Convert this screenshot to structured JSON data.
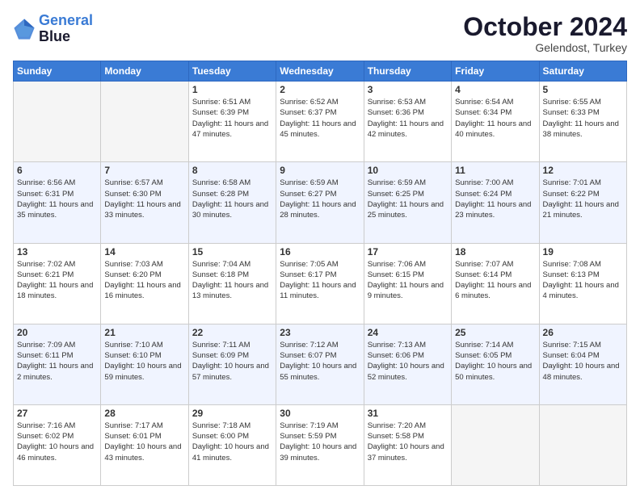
{
  "logo": {
    "line1": "General",
    "line2": "Blue"
  },
  "title": "October 2024",
  "subtitle": "Gelendost, Turkey",
  "days_header": [
    "Sunday",
    "Monday",
    "Tuesday",
    "Wednesday",
    "Thursday",
    "Friday",
    "Saturday"
  ],
  "weeks": [
    {
      "shaded": false,
      "days": [
        {
          "num": "",
          "info": ""
        },
        {
          "num": "",
          "info": ""
        },
        {
          "num": "1",
          "info": "Sunrise: 6:51 AM\nSunset: 6:39 PM\nDaylight: 11 hours\nand 47 minutes."
        },
        {
          "num": "2",
          "info": "Sunrise: 6:52 AM\nSunset: 6:37 PM\nDaylight: 11 hours\nand 45 minutes."
        },
        {
          "num": "3",
          "info": "Sunrise: 6:53 AM\nSunset: 6:36 PM\nDaylight: 11 hours\nand 42 minutes."
        },
        {
          "num": "4",
          "info": "Sunrise: 6:54 AM\nSunset: 6:34 PM\nDaylight: 11 hours\nand 40 minutes."
        },
        {
          "num": "5",
          "info": "Sunrise: 6:55 AM\nSunset: 6:33 PM\nDaylight: 11 hours\nand 38 minutes."
        }
      ]
    },
    {
      "shaded": true,
      "days": [
        {
          "num": "6",
          "info": "Sunrise: 6:56 AM\nSunset: 6:31 PM\nDaylight: 11 hours\nand 35 minutes."
        },
        {
          "num": "7",
          "info": "Sunrise: 6:57 AM\nSunset: 6:30 PM\nDaylight: 11 hours\nand 33 minutes."
        },
        {
          "num": "8",
          "info": "Sunrise: 6:58 AM\nSunset: 6:28 PM\nDaylight: 11 hours\nand 30 minutes."
        },
        {
          "num": "9",
          "info": "Sunrise: 6:59 AM\nSunset: 6:27 PM\nDaylight: 11 hours\nand 28 minutes."
        },
        {
          "num": "10",
          "info": "Sunrise: 6:59 AM\nSunset: 6:25 PM\nDaylight: 11 hours\nand 25 minutes."
        },
        {
          "num": "11",
          "info": "Sunrise: 7:00 AM\nSunset: 6:24 PM\nDaylight: 11 hours\nand 23 minutes."
        },
        {
          "num": "12",
          "info": "Sunrise: 7:01 AM\nSunset: 6:22 PM\nDaylight: 11 hours\nand 21 minutes."
        }
      ]
    },
    {
      "shaded": false,
      "days": [
        {
          "num": "13",
          "info": "Sunrise: 7:02 AM\nSunset: 6:21 PM\nDaylight: 11 hours\nand 18 minutes."
        },
        {
          "num": "14",
          "info": "Sunrise: 7:03 AM\nSunset: 6:20 PM\nDaylight: 11 hours\nand 16 minutes."
        },
        {
          "num": "15",
          "info": "Sunrise: 7:04 AM\nSunset: 6:18 PM\nDaylight: 11 hours\nand 13 minutes."
        },
        {
          "num": "16",
          "info": "Sunrise: 7:05 AM\nSunset: 6:17 PM\nDaylight: 11 hours\nand 11 minutes."
        },
        {
          "num": "17",
          "info": "Sunrise: 7:06 AM\nSunset: 6:15 PM\nDaylight: 11 hours\nand 9 minutes."
        },
        {
          "num": "18",
          "info": "Sunrise: 7:07 AM\nSunset: 6:14 PM\nDaylight: 11 hours\nand 6 minutes."
        },
        {
          "num": "19",
          "info": "Sunrise: 7:08 AM\nSunset: 6:13 PM\nDaylight: 11 hours\nand 4 minutes."
        }
      ]
    },
    {
      "shaded": true,
      "days": [
        {
          "num": "20",
          "info": "Sunrise: 7:09 AM\nSunset: 6:11 PM\nDaylight: 11 hours\nand 2 minutes."
        },
        {
          "num": "21",
          "info": "Sunrise: 7:10 AM\nSunset: 6:10 PM\nDaylight: 10 hours\nand 59 minutes."
        },
        {
          "num": "22",
          "info": "Sunrise: 7:11 AM\nSunset: 6:09 PM\nDaylight: 10 hours\nand 57 minutes."
        },
        {
          "num": "23",
          "info": "Sunrise: 7:12 AM\nSunset: 6:07 PM\nDaylight: 10 hours\nand 55 minutes."
        },
        {
          "num": "24",
          "info": "Sunrise: 7:13 AM\nSunset: 6:06 PM\nDaylight: 10 hours\nand 52 minutes."
        },
        {
          "num": "25",
          "info": "Sunrise: 7:14 AM\nSunset: 6:05 PM\nDaylight: 10 hours\nand 50 minutes."
        },
        {
          "num": "26",
          "info": "Sunrise: 7:15 AM\nSunset: 6:04 PM\nDaylight: 10 hours\nand 48 minutes."
        }
      ]
    },
    {
      "shaded": false,
      "days": [
        {
          "num": "27",
          "info": "Sunrise: 7:16 AM\nSunset: 6:02 PM\nDaylight: 10 hours\nand 46 minutes."
        },
        {
          "num": "28",
          "info": "Sunrise: 7:17 AM\nSunset: 6:01 PM\nDaylight: 10 hours\nand 43 minutes."
        },
        {
          "num": "29",
          "info": "Sunrise: 7:18 AM\nSunset: 6:00 PM\nDaylight: 10 hours\nand 41 minutes."
        },
        {
          "num": "30",
          "info": "Sunrise: 7:19 AM\nSunset: 5:59 PM\nDaylight: 10 hours\nand 39 minutes."
        },
        {
          "num": "31",
          "info": "Sunrise: 7:20 AM\nSunset: 5:58 PM\nDaylight: 10 hours\nand 37 minutes."
        },
        {
          "num": "",
          "info": ""
        },
        {
          "num": "",
          "info": ""
        }
      ]
    }
  ]
}
